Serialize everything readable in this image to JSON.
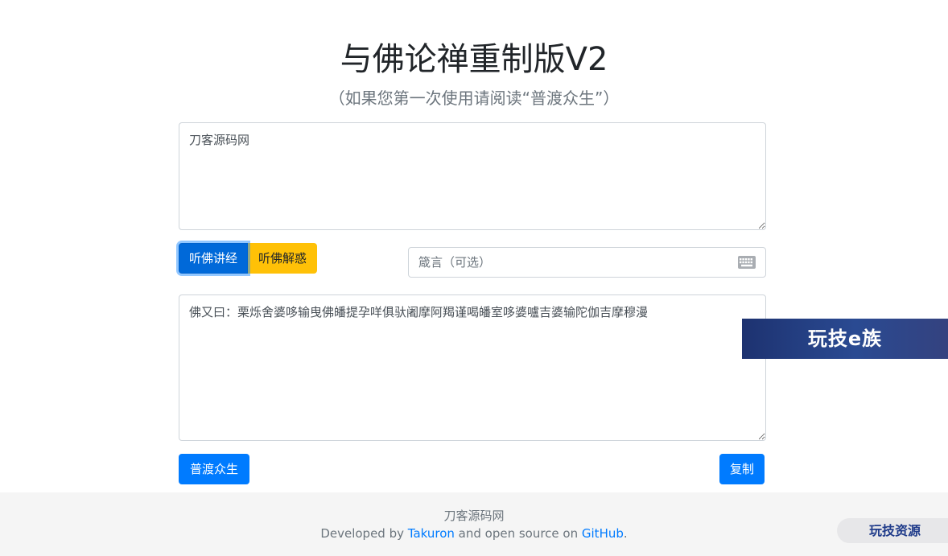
{
  "header": {
    "title": "与佛论禅重制版V2",
    "subtitle": "（如果您第一次使用请阅读“普渡众生”）"
  },
  "input": {
    "value": "刀客源码网"
  },
  "actions": {
    "encode_label": "听佛讲经",
    "decode_label": "听佛解惑"
  },
  "key": {
    "placeholder": "箴言（可选）",
    "icon": "keyboard-icon"
  },
  "output": {
    "value": "佛又曰：栗烁舍婆哆输曳佛皤提孕咩俱驮阇摩阿羯谨喝皤室哆婆嚧吉婆输陀伽吉摩穆漫"
  },
  "bottom": {
    "about_label": "普渡众生",
    "copy_label": "复制"
  },
  "footer": {
    "site": "刀客源码网",
    "dev_prefix": "Developed by ",
    "author": "Takuron",
    "dev_middle": " and open source on ",
    "repo": "GitHub",
    "dev_suffix": "."
  },
  "watermarks": {
    "banner": "玩技e族",
    "pill": "玩技资源"
  },
  "colors": {
    "primary": "#007bff",
    "warning": "#ffc107",
    "footer_bg": "#f5f5f5"
  }
}
